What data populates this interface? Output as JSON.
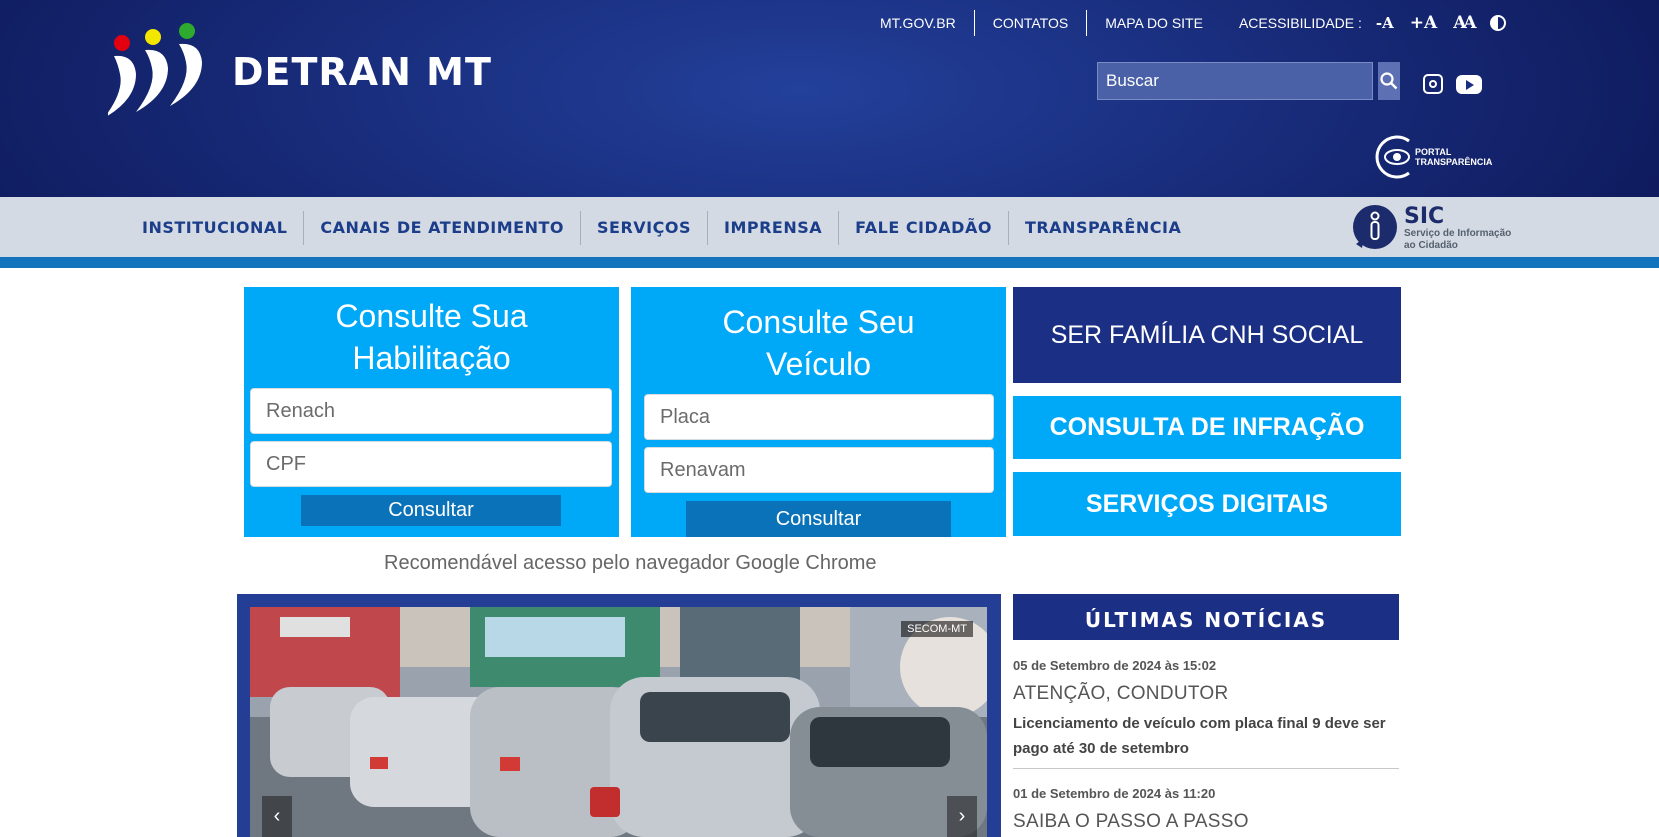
{
  "header": {
    "title": "DETRAN MT",
    "top_links": [
      "MT.GOV.BR",
      "CONTATOS",
      "MAPA DO SITE"
    ],
    "accessibility": {
      "label": "ACESSIBILIDADE :",
      "decrease": "-A",
      "increase": "+A",
      "reset": "AA"
    },
    "search": {
      "placeholder": "Buscar"
    },
    "transparency": {
      "line1": "PORTAL",
      "line2": "TRANSPARÊNCIA"
    }
  },
  "nav": {
    "items": [
      "INSTITUCIONAL",
      "CANAIS DE ATENDIMENTO",
      "SERVIÇOS",
      "IMPRENSA",
      "FALE CIDADÃO",
      "TRANSPARÊNCIA"
    ],
    "sic": {
      "title": "SIC",
      "line1": "Serviço de Informação",
      "line2": "ao Cidadão"
    }
  },
  "cards": {
    "license": {
      "title_line1": "Consulte Sua",
      "title_line2": "Habilitação",
      "field1_placeholder": "Renach",
      "field2_placeholder": "CPF",
      "button": "Consultar"
    },
    "vehicle": {
      "title_line1": "Consulte Seu",
      "title_line2": "Veículo",
      "field1_placeholder": "Placa",
      "field2_placeholder": "Renavam",
      "button": "Consultar"
    }
  },
  "side_buttons": {
    "cnh_social": "SER FAMÍLIA CNH SOCIAL",
    "infraction": "CONSULTA DE INFRAÇÃO",
    "digital": "SERVIÇOS DIGITAIS"
  },
  "recommend": "Recomendável acesso pelo navegador Google Chrome",
  "slider": {
    "credit": "SECOM-MT",
    "prev": "‹",
    "next": "›"
  },
  "news": {
    "heading": "ÚLTIMAS NOTÍCIAS",
    "items": [
      {
        "date": "05 de Setembro de 2024 às 15:02",
        "category": "ATENÇÃO, CONDUTOR",
        "text": "Licenciamento de veículo com placa final 9 deve ser pago até 30 de setembro"
      },
      {
        "date": "01 de Setembro de 2024 às 11:20",
        "category": "SAIBA O PASSO A PASSO",
        "text": ""
      }
    ]
  },
  "colors": {
    "header_bg": "#1a2f80",
    "nav_bg": "#d4dae3",
    "accent_blue": "#00a8f8",
    "dark_blue": "#1b2f84",
    "logo_red": "#e3000f",
    "logo_yellow": "#f3e600",
    "logo_green": "#2eaa2e"
  }
}
